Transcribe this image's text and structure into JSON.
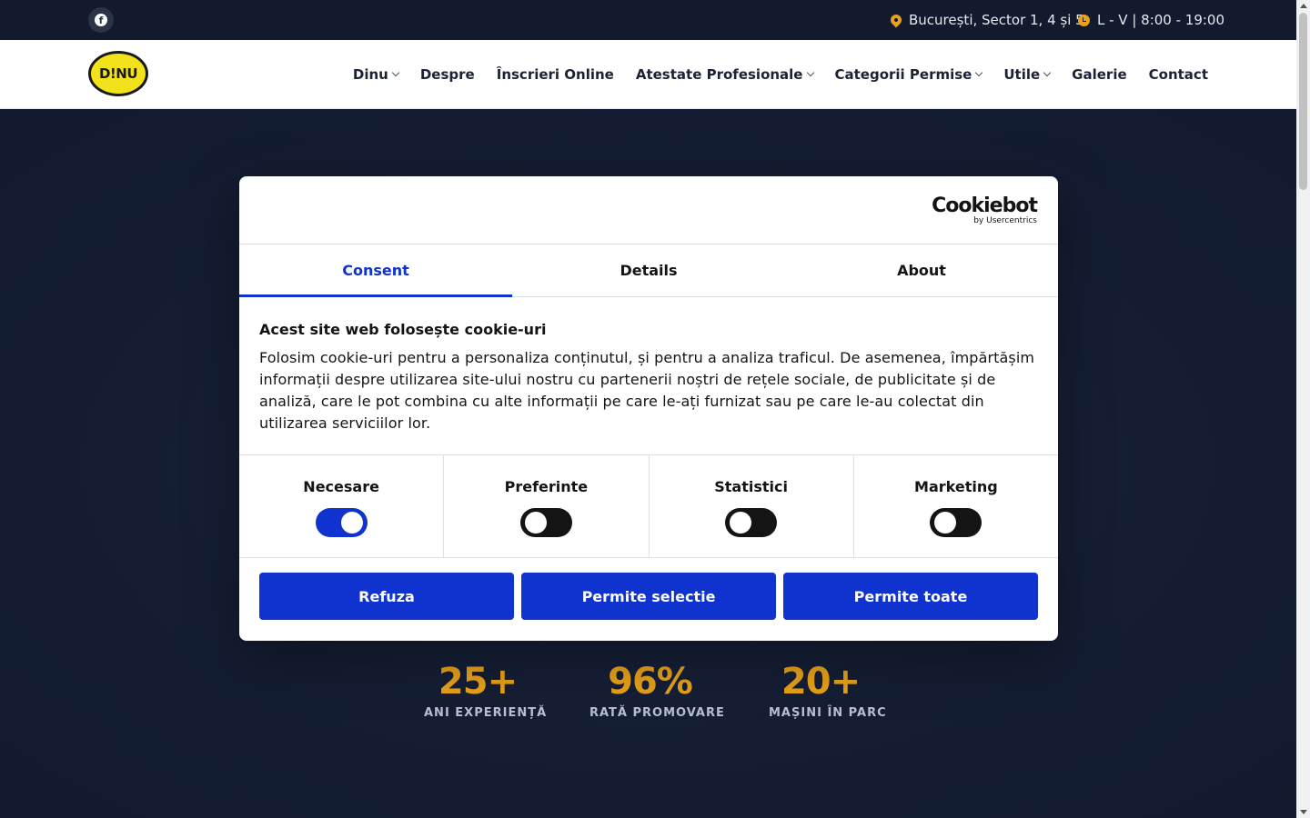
{
  "topbar": {
    "facebook_icon": "f",
    "address": "București, Sector 1, 4 și 5",
    "hours": "L - V | 8:00 - 19:00"
  },
  "header": {
    "logo_text": "D!NU",
    "nav": [
      {
        "label": "Dinu",
        "dropdown": true
      },
      {
        "label": "Despre",
        "dropdown": false
      },
      {
        "label": "Înscrieri Online",
        "dropdown": false
      },
      {
        "label": "Atestate Profesionale",
        "dropdown": true
      },
      {
        "label": "Categorii Permise",
        "dropdown": true
      },
      {
        "label": "Utile",
        "dropdown": true
      },
      {
        "label": "Galerie",
        "dropdown": false
      },
      {
        "label": "Contact",
        "dropdown": false
      }
    ]
  },
  "stats": [
    {
      "value": "25+",
      "label": "ANI EXPERIENȚĂ"
    },
    {
      "value": "96%",
      "label": "RATĂ PROMOVARE"
    },
    {
      "value": "20+",
      "label": "MAȘINI ÎN PARC"
    }
  ],
  "cookie": {
    "brand": "Cookiebot",
    "brand_sub": "by Usercentrics",
    "tabs": [
      "Consent",
      "Details",
      "About"
    ],
    "active_tab": "Consent",
    "title": "Acest site web folosește cookie-uri",
    "text": "Folosim cookie-uri pentru a personaliza conținutul, și pentru a analiza traficul. De asemenea, împărtășim informații despre utilizarea site-ului nostru cu partenerii noștri de rețele sociale, de publicitate și de analiză, care le pot combina cu alte informații pe care le-ați furnizat sau pe care le-au colectat din utilizarea serviciilor lor.",
    "toggles": [
      {
        "label": "Necesare",
        "on": true
      },
      {
        "label": "Preferinte",
        "on": false
      },
      {
        "label": "Statistici",
        "on": false
      },
      {
        "label": "Marketing",
        "on": false
      }
    ],
    "buttons": [
      "Refuza",
      "Permite selectie",
      "Permite toate"
    ],
    "accent_color": "#1032cf"
  },
  "colors": {
    "topbar_bg": "#121a2d",
    "hero_bg": "#111a2e",
    "stat_value": "#e8a21a"
  }
}
